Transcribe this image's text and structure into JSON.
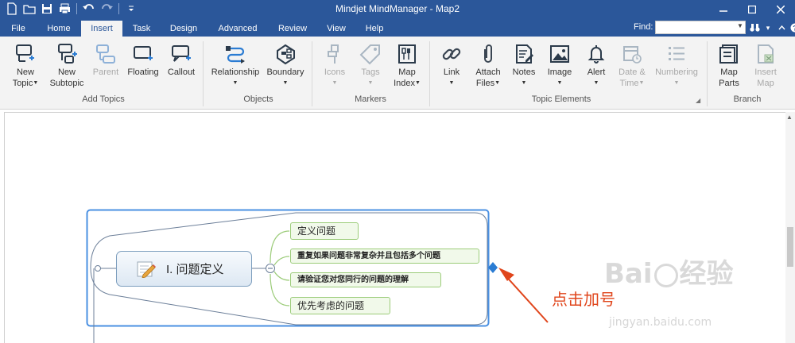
{
  "window": {
    "title": "Mindjet MindManager - Map2"
  },
  "tabs": [
    {
      "label": "File"
    },
    {
      "label": "Home"
    },
    {
      "label": "Insert"
    },
    {
      "label": "Task"
    },
    {
      "label": "Design"
    },
    {
      "label": "Advanced"
    },
    {
      "label": "Review"
    },
    {
      "label": "View"
    },
    {
      "label": "Help"
    }
  ],
  "active_tab": "Insert",
  "find": {
    "label": "Find:",
    "value": ""
  },
  "ribbon": {
    "groups": [
      {
        "label": "Add Topics"
      },
      {
        "label": "Objects"
      },
      {
        "label": "Markers"
      },
      {
        "label": "Topic Elements"
      },
      {
        "label": "Branch"
      }
    ],
    "buttons": [
      {
        "line1": "New",
        "line2": "Topic",
        "icon": "new-topic-icon",
        "enabled": true
      },
      {
        "line1": "New",
        "line2": "Subtopic",
        "icon": "new-subtopic-icon",
        "enabled": true
      },
      {
        "line1": "Parent",
        "line2": "",
        "icon": "parent-icon",
        "enabled": false
      },
      {
        "line1": "Floating",
        "line2": "",
        "icon": "floating-icon",
        "enabled": true
      },
      {
        "line1": "Callout",
        "line2": "",
        "icon": "callout-icon",
        "enabled": true
      },
      {
        "line1": "Relationship",
        "line2": "",
        "icon": "relationship-icon",
        "enabled": true
      },
      {
        "line1": "Boundary",
        "line2": "",
        "icon": "boundary-icon",
        "enabled": true
      },
      {
        "line1": "Icons",
        "line2": "",
        "icon": "icons-icon",
        "enabled": false
      },
      {
        "line1": "Tags",
        "line2": "",
        "icon": "tags-icon",
        "enabled": false
      },
      {
        "line1": "Map",
        "line2": "Index",
        "icon": "map-index-icon",
        "enabled": true
      },
      {
        "line1": "Link",
        "line2": "",
        "icon": "link-icon",
        "enabled": true
      },
      {
        "line1": "Attach",
        "line2": "Files",
        "icon": "attach-files-icon",
        "enabled": true
      },
      {
        "line1": "Notes",
        "line2": "",
        "icon": "notes-icon",
        "enabled": true
      },
      {
        "line1": "Image",
        "line2": "",
        "icon": "image-icon",
        "enabled": true
      },
      {
        "line1": "Alert",
        "line2": "",
        "icon": "alert-icon",
        "enabled": true
      },
      {
        "line1": "Date &",
        "line2": "Time",
        "icon": "date-time-icon",
        "enabled": false
      },
      {
        "line1": "Numbering",
        "line2": "",
        "icon": "numbering-icon",
        "enabled": false
      },
      {
        "line1": "Map",
        "line2": "Parts",
        "icon": "map-parts-icon",
        "enabled": true
      },
      {
        "line1": "Insert",
        "line2": "Map",
        "icon": "insert-map-icon",
        "enabled": false
      }
    ]
  },
  "map": {
    "central_topic": "I. 问题定义",
    "subtopics": [
      {
        "text": "定义问题"
      },
      {
        "text": "重复如果问题非常复杂并且包括多个问题"
      },
      {
        "text": "请验证您对您同行的问题的理解"
      },
      {
        "text": "优先考虑的问题"
      }
    ]
  },
  "annotation": {
    "text": "点击加号",
    "color": "#e0451b"
  },
  "watermark": {
    "brand": "Baidu经验",
    "url": "jingyan.baidu.com"
  },
  "colors": {
    "titlebar": "#2b579a",
    "ribbon": "#f3f3f3",
    "accent": "#4a90e2",
    "subtopic_border": "#9ccc7a"
  }
}
